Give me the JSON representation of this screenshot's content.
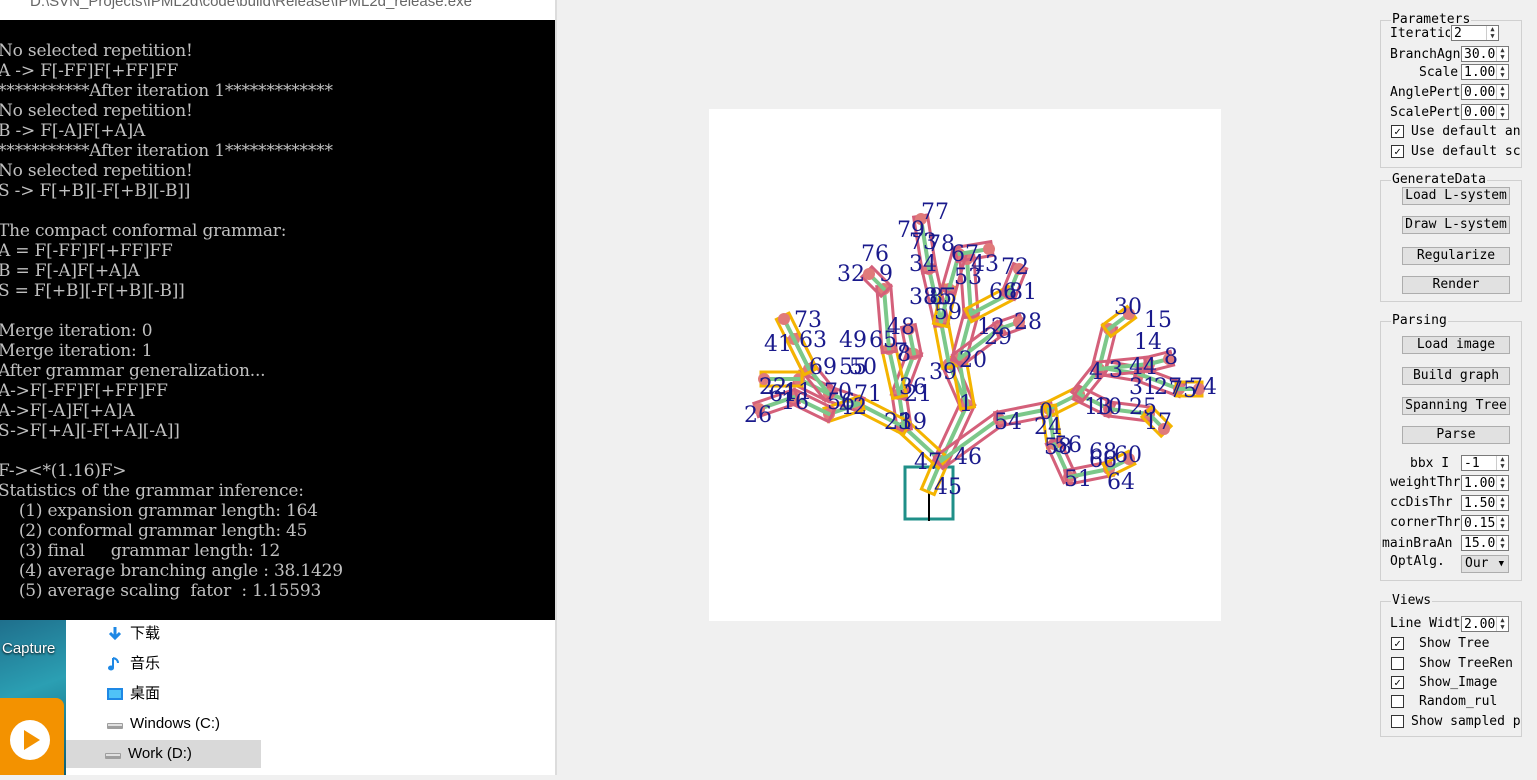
{
  "console": {
    "title": "D:\\SVN_Projects\\IPML2d\\code\\build\\Release\\IPML2d_release.exe",
    "lines": [
      "No selected repetition!",
      "A -> F[-FF]F[+FF]FF",
      "***********After iteration 1*************",
      "No selected repetition!",
      "B -> F[-A]F[+A]A",
      "***********After iteration 1*************",
      "No selected repetition!",
      "S -> F[+B][-F[+B][-B]]",
      "",
      "The compact conformal grammar:",
      "A = F[-FF]F[+FF]FF",
      "B = F[-A]F[+A]A",
      "S = F[+B][-F[+B][-B]]",
      "",
      "Merge iteration: 0",
      "Merge iteration: 1",
      "After grammar generalization...",
      "A->F[-FF]F[+FF]FF",
      "A->F[-A]F[+A]A",
      "S->F[+A][-F[+A][-A]]",
      "",
      "F-><*(1.16)F>",
      "Statistics of the grammar inference:",
      "    (1) expansion grammar length: 164",
      "    (2) conformal grammar length: 45",
      "    (3) final     grammar length: 12",
      "    (4) average branching angle : 38.1429",
      "    (5) average scaling  fator  : 1.15593"
    ]
  },
  "desktop": {
    "caption": "Capture"
  },
  "explorer": {
    "items": [
      {
        "label": "下载",
        "icon": "download-arrow-icon"
      },
      {
        "label": "音乐",
        "icon": "music-note-icon"
      },
      {
        "label": "桌面",
        "icon": "desktop-folder-icon"
      },
      {
        "label": "Windows (C:)",
        "icon": "drive-icon"
      },
      {
        "label": "Work (D:)",
        "icon": "drive-icon"
      }
    ]
  },
  "canvas": {
    "labels": [
      "77",
      "79",
      "78",
      "73",
      "76",
      "32",
      "9",
      "34",
      "35",
      "67",
      "43",
      "72",
      "38",
      "85",
      "53",
      "59",
      "66",
      "81",
      "73",
      "63",
      "41",
      "48",
      "65",
      "49",
      "8",
      "7",
      "12",
      "29",
      "28",
      "30",
      "15",
      "14",
      "22",
      "20",
      "69",
      "55",
      "50",
      "61",
      "36",
      "21",
      "39",
      "4",
      "3",
      "44",
      "8",
      "27",
      "75",
      "74",
      "22",
      "11",
      "70",
      "71",
      "16",
      "56",
      "42",
      "1",
      "10",
      "13",
      "31",
      "25",
      "26",
      "23",
      "19",
      "54",
      "0",
      "24",
      "17",
      "47",
      "46",
      "58",
      "56",
      "68",
      "60",
      "45",
      "66",
      "51",
      "64"
    ]
  },
  "panel": {
    "parameters": {
      "title": "Parameters",
      "iteration_label": "Iteratio",
      "iteration_value": "2",
      "branch_angle_label": "BranchAgn",
      "branch_angle_value": "30.0",
      "scale_label": "Scale",
      "scale_value": "1.00",
      "angle_pert_label": "AnglePert",
      "angle_pert_value": "0.00",
      "scale_pert_label": "ScalePert",
      "scale_pert_value": "0.00",
      "use_default_angle": "Use default an",
      "use_default_scale": "Use default sc"
    },
    "generate": {
      "title": "GenerateData",
      "load": "Load L-system",
      "draw": "Draw L-system",
      "regularize": "Regularize",
      "render": "Render"
    },
    "parsing": {
      "title": "Parsing",
      "load_image": "Load image",
      "build_graph": "Build graph",
      "spanning_tree": "Spanning Tree",
      "parse": "Parse",
      "bbx_label": "bbx I",
      "bbx_value": "-1",
      "weight_label": "weightThr",
      "weight_value": "1.00",
      "ccdis_label": "ccDisThr",
      "ccdis_value": "1.50",
      "corner_label": "cornerThr",
      "corner_value": "0.15",
      "mainbra_label": "mainBraAn",
      "mainbra_value": "15.0",
      "optalg_label": "OptAlg.",
      "optalg_value": "Our"
    },
    "views": {
      "title": "Views",
      "line_width_label": "Line Widt",
      "line_width_value": "2.00",
      "show_tree": "Show Tree",
      "show_tree_ren": "Show TreeRen",
      "show_image": "Show_Image",
      "random_rul": "Random_rul",
      "show_sampled": "Show sampled p"
    }
  },
  "colors": {
    "console_bg": "#000000",
    "console_fg": "#c0c0c0",
    "branch_green": "#7cc88a",
    "box_yellow": "#f4b400",
    "box_pink": "#d4607a",
    "node_pink": "#e07a7a",
    "trunk_teal": "#1f8f88",
    "label_blue": "#1a1a8c"
  }
}
